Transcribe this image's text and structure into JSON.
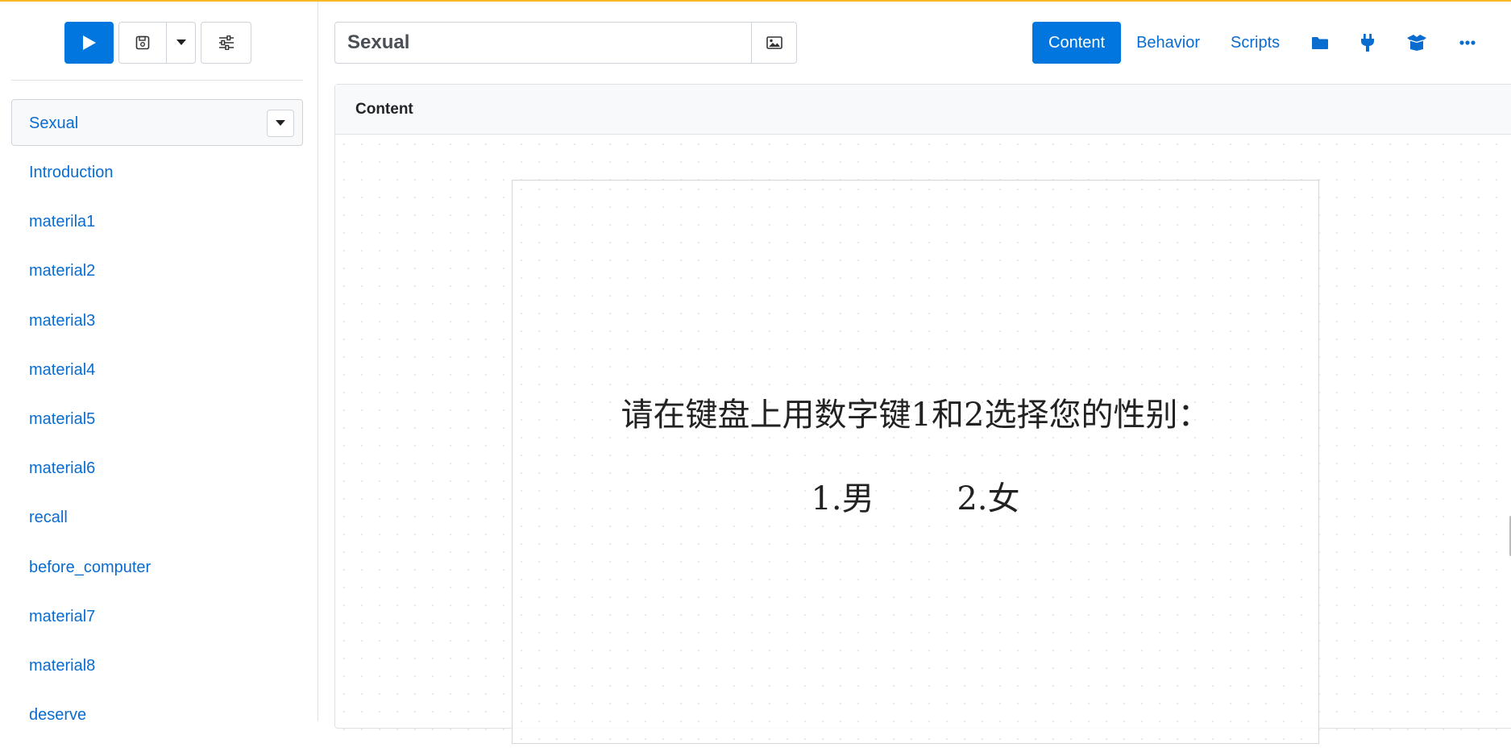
{
  "toolbar": {
    "play_icon": "play-icon",
    "save_icon": "save-icon",
    "caret_icon": "caret-down-icon",
    "settings_icon": "sliders-icon"
  },
  "component_select": {
    "selected": "Sexual"
  },
  "sidebar": {
    "items": [
      {
        "label": "Introduction"
      },
      {
        "label": "materila1"
      },
      {
        "label": "material2"
      },
      {
        "label": "material3"
      },
      {
        "label": "material4"
      },
      {
        "label": "material5"
      },
      {
        "label": "material6"
      },
      {
        "label": "recall"
      },
      {
        "label": "before_computer"
      },
      {
        "label": "material7"
      },
      {
        "label": "material8"
      },
      {
        "label": "deserve"
      }
    ]
  },
  "header": {
    "title_value": "Sexual",
    "tabs": {
      "content": "Content",
      "behavior": "Behavior",
      "scripts": "Scripts"
    },
    "icons": [
      "folder-icon",
      "plug-icon",
      "box-open-icon",
      "ellipsis-icon"
    ]
  },
  "panel": {
    "title": "Content",
    "screen": {
      "prompt": "请在键盘上用数字键1和2选择您的性别：",
      "option_1": "1.男",
      "option_2": "2.女"
    }
  },
  "colors": {
    "accent": "#0076de",
    "link": "#0a6ccf",
    "top_line": "#f7b924"
  }
}
